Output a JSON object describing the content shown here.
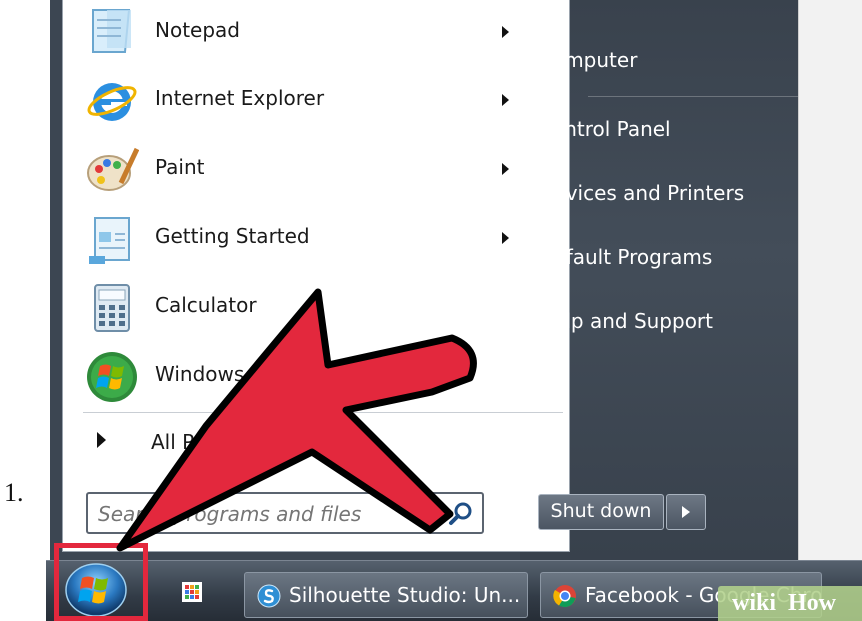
{
  "list_marker": "1.",
  "start_menu": {
    "programs": [
      {
        "label": "Notepad",
        "icon": "notepad-icon",
        "has_submenu": true
      },
      {
        "label": "Internet Explorer",
        "icon": "internet-explorer-icon",
        "has_submenu": true
      },
      {
        "label": "Paint",
        "icon": "paint-palette-icon",
        "has_submenu": true
      },
      {
        "label": "Getting Started",
        "icon": "getting-started-icon",
        "has_submenu": true
      },
      {
        "label": "Calculator",
        "icon": "calculator-icon",
        "has_submenu": false
      },
      {
        "label": "Windows Media Center",
        "icon": "windows-logo-icon",
        "has_submenu": false
      }
    ],
    "all_programs": "All Programs",
    "search_placeholder": "Search programs and files",
    "right_items": [
      "Computer",
      "Control Panel",
      "Devices and Printers",
      "Default Programs",
      "Help and Support"
    ],
    "shutdown_label": "Shut down"
  },
  "taskbar": {
    "buttons": [
      {
        "label": "Silhouette Studio: Un...",
        "icon": "silhouette-studio-icon"
      },
      {
        "label": "Facebook - Google Chrome",
        "icon": "chrome-icon"
      }
    ]
  },
  "watermark": {
    "wiki": "wiki",
    "how": "How"
  },
  "colors": {
    "arrow_red": "#e3283d",
    "menu_dark": "#3c4652",
    "taskbar": "#323b46"
  }
}
